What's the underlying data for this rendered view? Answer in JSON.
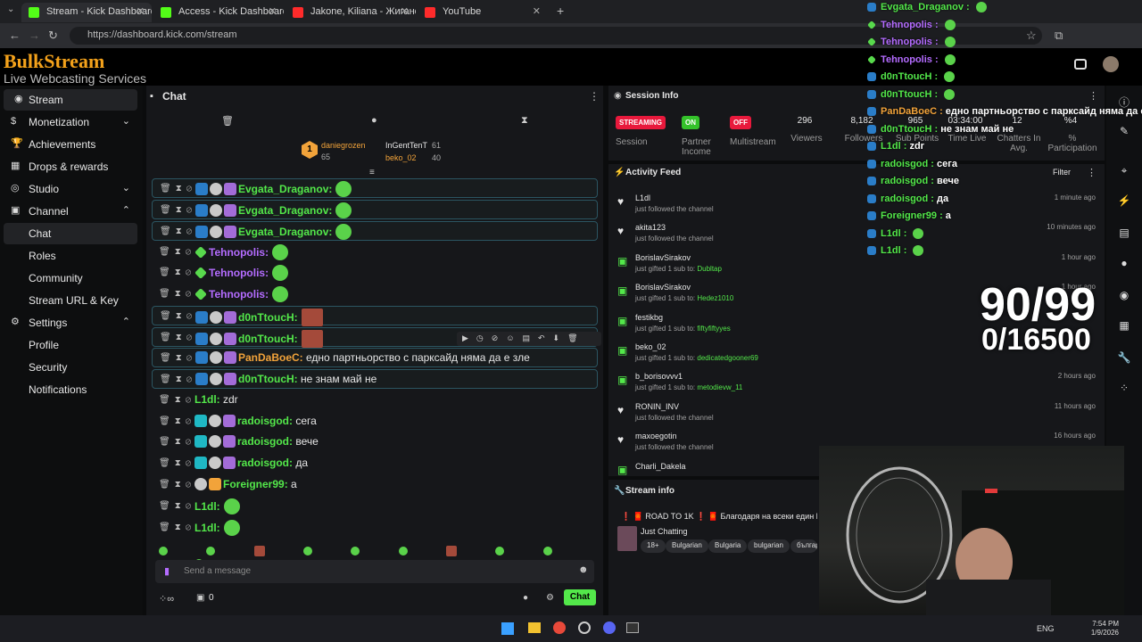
{
  "browser": {
    "tabs": [
      {
        "label": "Stream - Kick Dashboard",
        "fav": "#53fc18",
        "active": true
      },
      {
        "label": "Access - Kick Dashboard",
        "fav": "#53fc18",
        "active": false
      },
      {
        "label": "Jakone, Kiliana - Жигански",
        "fav": "#ff2b2b",
        "active": false
      },
      {
        "label": "YouTube",
        "fav": "#ff2b2b",
        "active": false
      }
    ],
    "url": "https://dashboard.kick.com/stream"
  },
  "logo": {
    "line1": "BulkStream",
    "line2": "Live Webcasting Services"
  },
  "sidebar": {
    "items": [
      {
        "label": "Stream",
        "selected": true
      },
      {
        "label": "Monetization"
      },
      {
        "label": "Achievements"
      },
      {
        "label": "Drops & rewards"
      },
      {
        "label": "Studio"
      },
      {
        "label": "Channel"
      },
      {
        "label": "Chat",
        "selected": true
      },
      {
        "label": "Roles"
      },
      {
        "label": "Community"
      },
      {
        "label": "Stream URL & Key"
      },
      {
        "label": "Settings"
      },
      {
        "label": "Profile"
      },
      {
        "label": "Security"
      },
      {
        "label": "Notifications"
      }
    ]
  },
  "chat": {
    "title": "Chat",
    "leaders": {
      "top": {
        "name": "daniegrozen",
        "rank": "1",
        "count": "65"
      },
      "second": {
        "name": "InGentTenT",
        "count": "61"
      },
      "third": {
        "name": "beko_02",
        "count": "40"
      }
    },
    "messages": [
      {
        "user": "Evgata_Draganov",
        "color": "#53e84a",
        "text": "",
        "hl": true
      },
      {
        "user": "Evgata_Draganov",
        "color": "#53e84a",
        "text": "",
        "hl": true
      },
      {
        "user": "Evgata_Draganov",
        "color": "#53e84a",
        "text": "",
        "hl": true
      },
      {
        "user": "Tehnopolis",
        "color": "#b46cff",
        "text": "",
        "hl": false
      },
      {
        "user": "Tehnopolis",
        "color": "#b46cff",
        "text": "",
        "hl": false
      },
      {
        "user": "Tehnopolis",
        "color": "#b46cff",
        "text": "",
        "hl": false
      },
      {
        "user": "d0nTtoucH",
        "color": "#53e84a",
        "text": "",
        "hl": true
      },
      {
        "user": "d0nTtoucH",
        "color": "#53e84a",
        "text": "",
        "hl": true
      },
      {
        "user": "PanDaBoeC",
        "color": "#f2a33a",
        "text": "едно партньорство с парксайд няма да е зле",
        "hl": true
      },
      {
        "user": "d0nTtoucH",
        "color": "#53e84a",
        "text": "не знам май не",
        "hl": true
      },
      {
        "user": "L1dl",
        "color": "#53e84a",
        "text": "zdr",
        "hl": false
      },
      {
        "user": "radoisgod",
        "color": "#53e84a",
        "text": "сега",
        "hl": false
      },
      {
        "user": "radoisgod",
        "color": "#53e84a",
        "text": "вече",
        "hl": false
      },
      {
        "user": "radoisgod",
        "color": "#53e84a",
        "text": "да",
        "hl": false
      },
      {
        "user": "Foreigner99",
        "color": "#53e84a",
        "text": "а",
        "hl": false
      },
      {
        "user": "L1dl",
        "color": "#53e84a",
        "text": "",
        "hl": false
      },
      {
        "user": "L1dl",
        "color": "#53e84a",
        "text": "",
        "hl": false
      }
    ],
    "input_placeholder": "Send a message",
    "footer_count": "0",
    "send_label": "Chat"
  },
  "session": {
    "title": "Session Info",
    "pills": [
      {
        "label": "STREAMING",
        "color": "#e8193c",
        "caption": "Session"
      },
      {
        "label": "ON",
        "color": "#34c22a",
        "caption": "Partner Income"
      },
      {
        "label": "OFF",
        "color": "#e8193c",
        "caption": "Multistream"
      }
    ],
    "stats": [
      {
        "value": "296",
        "label": "Viewers"
      },
      {
        "value": "8,182",
        "label": "Followers"
      },
      {
        "value": "965",
        "label": "Sub Points"
      },
      {
        "value": "03:34:00",
        "label": "Time Live"
      },
      {
        "value": "12",
        "label": "Chatters In Avg."
      },
      {
        "value": "%4",
        "label": "% Participation"
      }
    ]
  },
  "activity": {
    "title": "Activity Feed",
    "filter": "Filter",
    "items": [
      {
        "icon": "heart",
        "name": "L1dl",
        "detail": "just followed the channel",
        "target": "",
        "time": "1 minute ago"
      },
      {
        "icon": "heart",
        "name": "akita123",
        "detail": "just followed the channel",
        "target": "",
        "time": "10 minutes ago"
      },
      {
        "icon": "gift",
        "name": "BorislavSirakov",
        "detail": "just gifted 1 sub to:",
        "target": "Dubltap",
        "time": "1 hour ago"
      },
      {
        "icon": "gift",
        "name": "BorislavSirakov",
        "detail": "just gifted 1 sub to:",
        "target": "Hedez1010",
        "time": "1 hour ago"
      },
      {
        "icon": "gift",
        "name": "festikbg",
        "detail": "just gifted 1 sub to:",
        "target": "fiftyfiftyyes",
        "time": ""
      },
      {
        "icon": "gift",
        "name": "beko_02",
        "detail": "just gifted 1 sub to:",
        "target": "dedicatedgooner69",
        "time": ""
      },
      {
        "icon": "gift",
        "name": "b_borisovvv1",
        "detail": "just gifted 1 sub to:",
        "target": "metodievw_11",
        "time": "2 hours ago"
      },
      {
        "icon": "heart",
        "name": "RONIN_INV",
        "detail": "just followed the channel",
        "target": "",
        "time": "11 hours ago"
      },
      {
        "icon": "heart",
        "name": "maxoegotin",
        "detail": "just followed the channel",
        "target": "",
        "time": "16 hours ago"
      },
      {
        "icon": "gift",
        "name": "Charli_Dakela",
        "detail": "",
        "target": "",
        "time": ""
      }
    ]
  },
  "stream_info": {
    "title": "Stream info",
    "stream_title": "❗ 🧧 ROAD TO 1K ❗ 🧧 Благодаря на всеки един Го",
    "category": "Just Chatting",
    "tags": [
      "18+",
      "Bulgarian",
      "Bulgaria",
      "bulgarian",
      "българ"
    ]
  },
  "overlay": {
    "chat": [
      {
        "user": "Evgata_Draganov",
        "color": "#53e84a",
        "text": ""
      },
      {
        "user": "Tehnopolis",
        "color": "#b46cff",
        "text": ""
      },
      {
        "user": "Tehnopolis",
        "color": "#b46cff",
        "text": ""
      },
      {
        "user": "Tehnopolis",
        "color": "#b46cff",
        "text": ""
      },
      {
        "user": "d0nTtoucH",
        "color": "#53e84a",
        "text": ""
      },
      {
        "user": "d0nTtoucH",
        "color": "#53e84a",
        "text": ""
      },
      {
        "user": "PanDaBoeC",
        "color": "#f2a33a",
        "text": "едно партньорство с парксайд няма да е"
      },
      {
        "user": "d0nTtoucH",
        "color": "#53e84a",
        "text": "не знам май не"
      },
      {
        "user": "L1dl",
        "color": "#53e84a",
        "text": "zdr"
      },
      {
        "user": "radoisgod",
        "color": "#53e84a",
        "text": "сега"
      },
      {
        "user": "radoisgod",
        "color": "#53e84a",
        "text": "вече"
      },
      {
        "user": "radoisgod",
        "color": "#53e84a",
        "text": "да"
      },
      {
        "user": "Foreigner99",
        "color": "#53e84a",
        "text": "а"
      },
      {
        "user": "L1dl",
        "color": "#53e84a",
        "text": ""
      },
      {
        "user": "L1dl",
        "color": "#53e84a",
        "text": ""
      }
    ],
    "goal1": "90/99",
    "goal2": "0/16500"
  },
  "taskbar": {
    "lang": "ENG",
    "time": "7:54 PM",
    "date": "1/9/2026"
  }
}
